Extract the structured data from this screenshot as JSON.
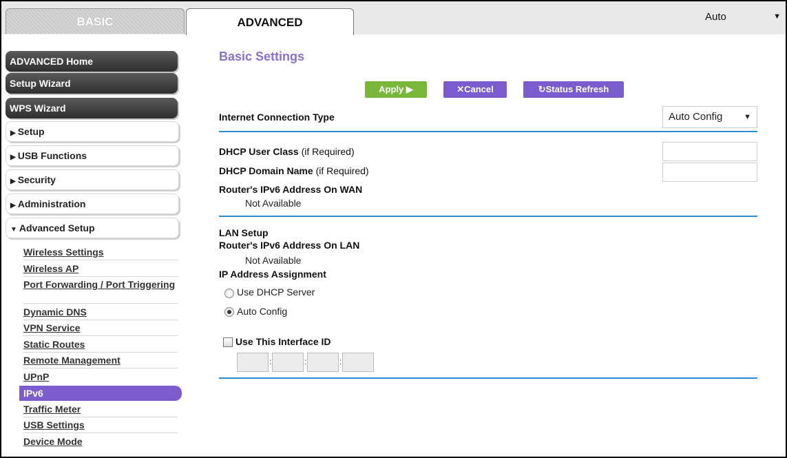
{
  "top_tabs": {
    "basic": "BASIC",
    "advanced": "ADVANCED"
  },
  "language": {
    "selected": "Auto"
  },
  "nav": {
    "dark_items": [
      "ADVANCED Home",
      "Setup Wizard",
      "WPS Wizard"
    ],
    "sections": [
      "Setup",
      "USB Functions",
      "Security",
      "Administration",
      "Advanced Setup"
    ],
    "advanced_setup_items": [
      "Wireless Settings",
      "Wireless AP",
      "Port Forwarding / Port Triggering",
      "Dynamic DNS",
      "VPN Service",
      "Static Routes",
      "Remote Management",
      "UPnP",
      "IPv6",
      "Traffic Meter",
      "USB Settings",
      "Device Mode"
    ],
    "active_item": "IPv6"
  },
  "main": {
    "title": "Basic Settings",
    "buttons": {
      "apply": "Apply ▶",
      "cancel": "✕Cancel",
      "refresh": "↻Status Refresh"
    },
    "internet_connection_type": {
      "label": "Internet Connection Type",
      "value": "Auto Config"
    },
    "dhcp_user_class": {
      "label": "DHCP User Class",
      "note": "(if Required)",
      "value": ""
    },
    "dhcp_domain_name": {
      "label": "DHCP Domain Name",
      "note": "(if Required)",
      "value": ""
    },
    "wan_ipv6": {
      "label": "Router's IPv6 Address On WAN",
      "value": "Not Available"
    },
    "lan_setup": {
      "label": "LAN Setup"
    },
    "lan_ipv6": {
      "label": "Router's IPv6 Address On LAN",
      "value": "Not Available"
    },
    "ip_assignment": {
      "label": "IP Address Assignment",
      "options": [
        "Use DHCP Server",
        "Auto Config"
      ],
      "selected": "Auto Config"
    },
    "interface_id": {
      "label": "Use This Interface ID",
      "checked": false,
      "fields": [
        "",
        "",
        "",
        ""
      ]
    }
  },
  "colors": {
    "accent_purple": "#7b5ccf",
    "apply_green": "#79b73b",
    "rule_blue": "#2a8bd6"
  }
}
